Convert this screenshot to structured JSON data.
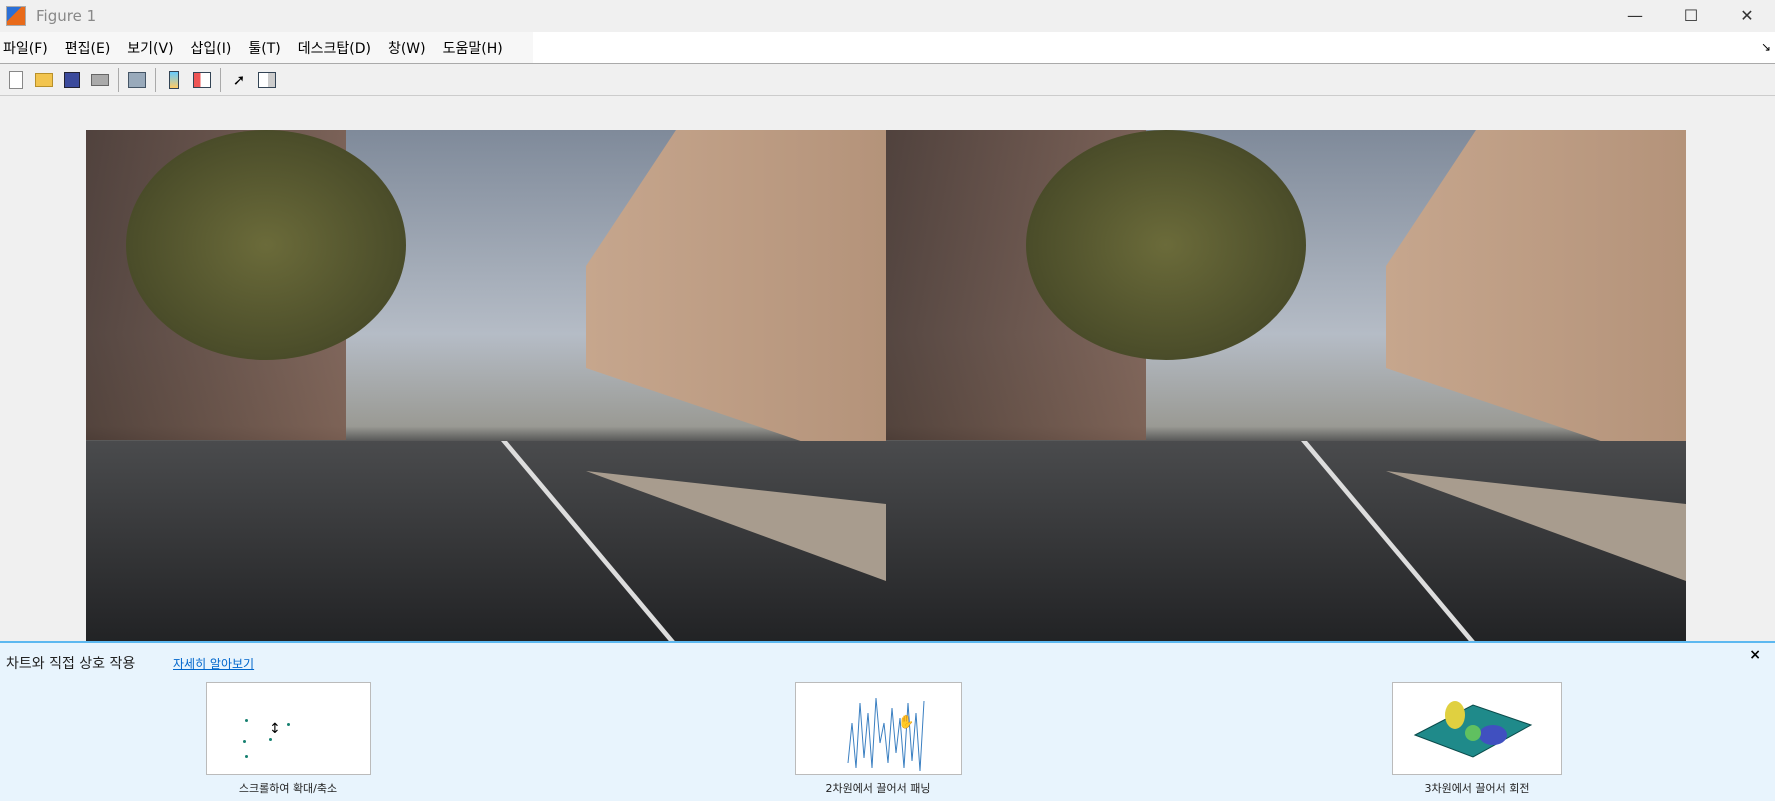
{
  "window": {
    "title": "Figure 1",
    "controls": [
      "—",
      "☐",
      "✕"
    ]
  },
  "menu": [
    "파일(F)",
    "편집(E)",
    "보기(V)",
    "삽입(I)",
    "툴(T)",
    "데스크탑(D)",
    "창(W)",
    "도움말(H)"
  ],
  "menu_dock": "↘",
  "toolbar": [
    "new-figure",
    "open",
    "save",
    "print",
    "link-plot",
    "insert-colorbar",
    "insert-legend",
    "edit-plot",
    "open-property-inspector"
  ],
  "panel": {
    "title": "차트와 직접 상호 작용",
    "learn_more": "자세히 알아보기",
    "close": "×",
    "items": [
      {
        "caption": "스크롤하여 확대/축소"
      },
      {
        "caption": "2차원에서 끌어서 패닝"
      },
      {
        "caption": "3차원에서 끌어서 회전"
      }
    ]
  }
}
